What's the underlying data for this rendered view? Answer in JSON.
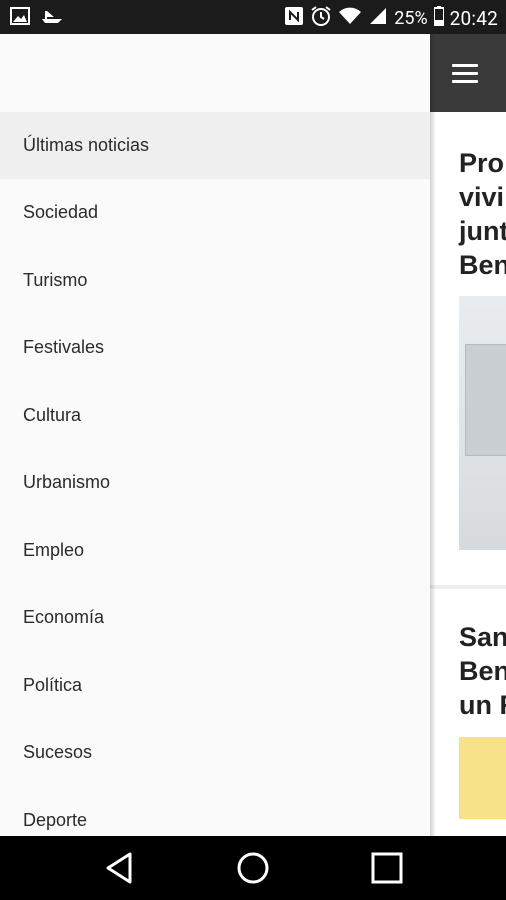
{
  "status_bar": {
    "icons_left": [
      "image-icon",
      "boat-icon"
    ],
    "icons_right": [
      "nfc-icon",
      "alarm-icon",
      "wifi-icon",
      "signal-icon",
      "battery-icon"
    ],
    "battery": "25%",
    "time": "20:42"
  },
  "drawer": {
    "items": [
      {
        "label": "Últimas noticias",
        "active": true
      },
      {
        "label": "Sociedad"
      },
      {
        "label": "Turismo"
      },
      {
        "label": "Festivales"
      },
      {
        "label": "Cultura"
      },
      {
        "label": "Urbanismo"
      },
      {
        "label": "Empleo"
      },
      {
        "label": "Economía"
      },
      {
        "label": "Política"
      },
      {
        "label": "Sucesos"
      },
      {
        "label": "Deporte"
      }
    ]
  },
  "app": {
    "toolbar_color": "#3a3a3a",
    "menu_icon": "hamburger-menu-icon",
    "articles": [
      {
        "title_visible": "Pro\nvivi\njunt\nBen"
      },
      {
        "title_visible": "San\nBen\nun F"
      }
    ]
  },
  "nav_bar": {
    "buttons": [
      "back-icon",
      "home-icon",
      "recent-apps-icon"
    ]
  }
}
